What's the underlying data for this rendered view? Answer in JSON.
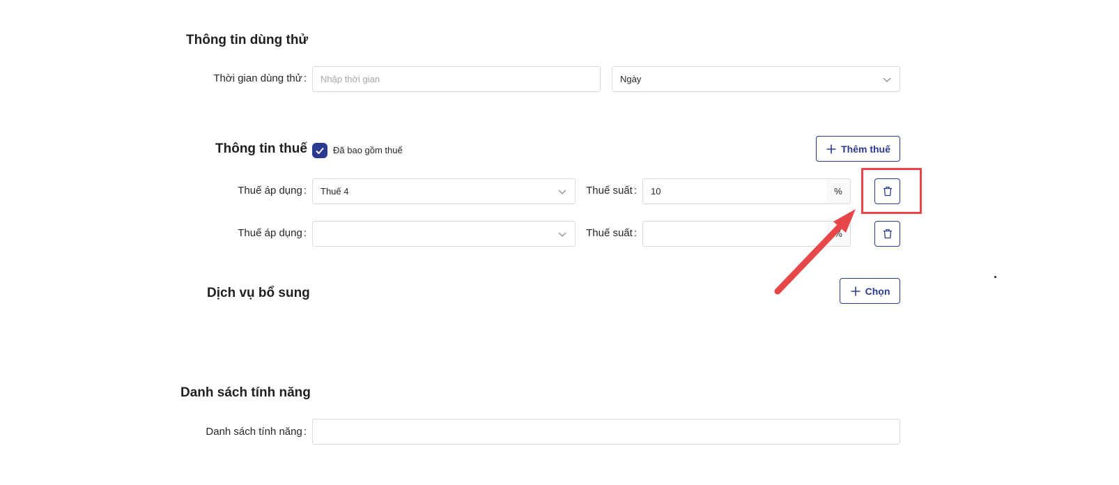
{
  "trial": {
    "title": "Thông tin dùng thử",
    "duration_label": "Thời gian dùng thử",
    "duration_placeholder": "Nhập thời gian",
    "unit_value": "Ngày"
  },
  "tax": {
    "title": "Thông tin thuế",
    "included_label": "Đã bao gồm thuế",
    "included_checked": true,
    "add_button": "Thêm thuế",
    "rows": [
      {
        "apply_label": "Thuế áp dụng",
        "apply_value": "Thuế 4",
        "rate_label": "Thuế suất",
        "rate_value": "10",
        "rate_unit": "%"
      },
      {
        "apply_label": "Thuế áp dụng",
        "apply_value": "",
        "rate_label": "Thuế suất",
        "rate_value": "",
        "rate_unit": "%"
      }
    ]
  },
  "services": {
    "title": "Dịch vụ bổ sung",
    "choose_button": "Chọn"
  },
  "features": {
    "title": "Danh sách tính năng",
    "list_label": "Danh sách tính năng",
    "list_value": ""
  },
  "colors": {
    "primary": "#2b3a8f",
    "annotation_red": "#e8474a",
    "border": "#d9d9d9"
  }
}
